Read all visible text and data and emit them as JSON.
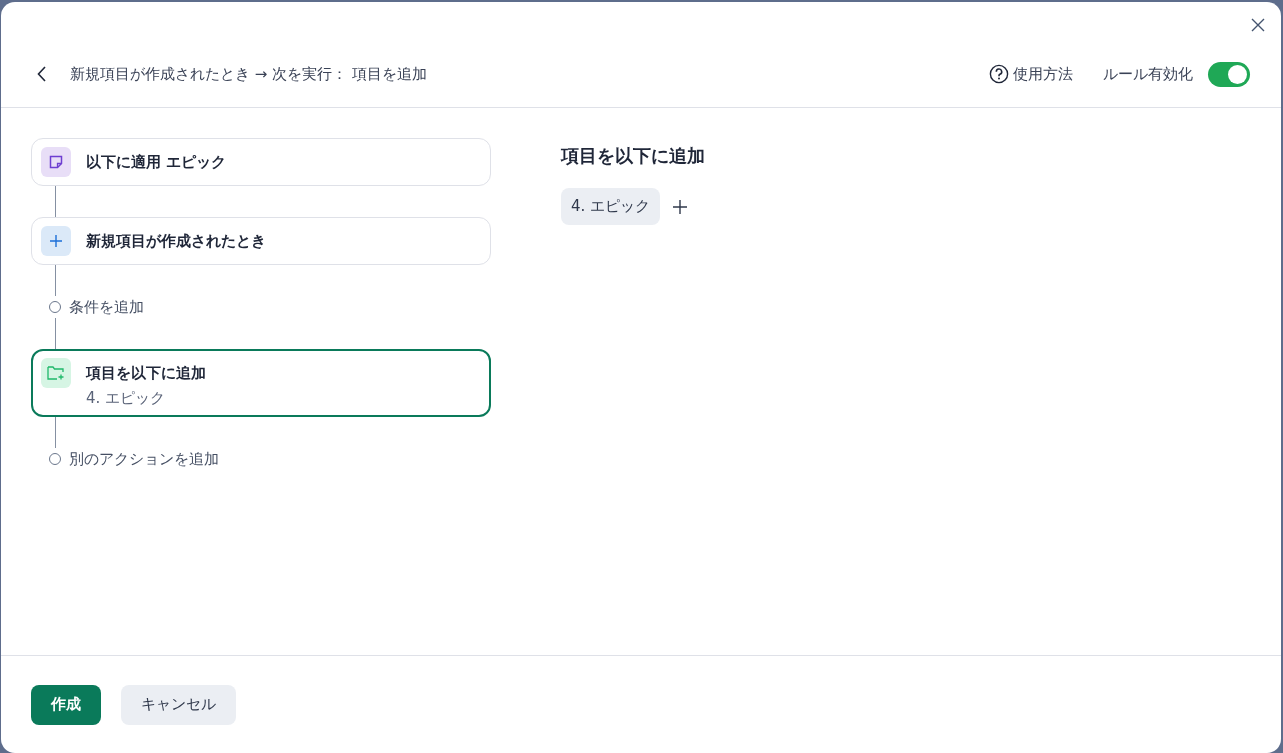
{
  "header": {
    "title": "新規項目が作成されたとき → 次を実行： 項目を追加",
    "help": "使用方法",
    "rule_toggle": {
      "label": "ルール有効化",
      "on": true
    }
  },
  "steps": [
    {
      "kind": "scope",
      "title": "以下に適用 エピック",
      "selected": false
    },
    {
      "kind": "trigger",
      "title": "新規項目が作成されたとき",
      "selected": false
    },
    {
      "kind": "add",
      "label": "条件を追加"
    },
    {
      "kind": "action",
      "title": "項目を以下に追加",
      "subtitle": "4. エピック",
      "selected": true
    },
    {
      "kind": "add",
      "label": "別のアクションを追加"
    }
  ],
  "detail": {
    "heading": "項目を以下に追加",
    "chips": [
      "4. エピック"
    ]
  },
  "footer": {
    "buttons": [
      {
        "label": "作成",
        "kind": "primary"
      },
      {
        "label": "キャンセル",
        "kind": "secondary"
      }
    ]
  }
}
